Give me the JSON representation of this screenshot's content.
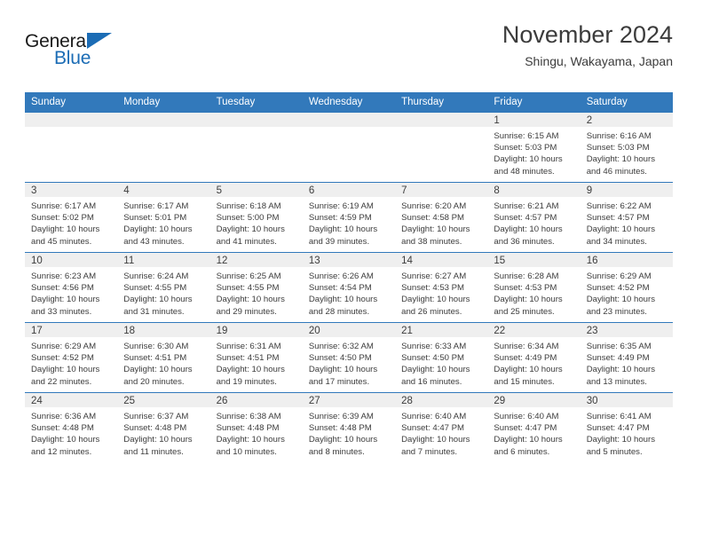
{
  "brand": {
    "name_part1": "General",
    "name_part2": "Blue",
    "accent_color": "#1b6cb5"
  },
  "header": {
    "title": "November 2024",
    "subtitle": "Shingu, Wakayama, Japan"
  },
  "theme": {
    "header_bg": "#3279bb",
    "daynum_bg": "#efefef",
    "text": "#3c3c3c"
  },
  "weekday_headers": [
    "Sunday",
    "Monday",
    "Tuesday",
    "Wednesday",
    "Thursday",
    "Friday",
    "Saturday"
  ],
  "weeks": [
    [
      {
        "day": "",
        "lines": []
      },
      {
        "day": "",
        "lines": []
      },
      {
        "day": "",
        "lines": []
      },
      {
        "day": "",
        "lines": []
      },
      {
        "day": "",
        "lines": []
      },
      {
        "day": "1",
        "lines": [
          "Sunrise: 6:15 AM",
          "Sunset: 5:03 PM",
          "Daylight: 10 hours",
          "and 48 minutes."
        ]
      },
      {
        "day": "2",
        "lines": [
          "Sunrise: 6:16 AM",
          "Sunset: 5:03 PM",
          "Daylight: 10 hours",
          "and 46 minutes."
        ]
      }
    ],
    [
      {
        "day": "3",
        "lines": [
          "Sunrise: 6:17 AM",
          "Sunset: 5:02 PM",
          "Daylight: 10 hours",
          "and 45 minutes."
        ]
      },
      {
        "day": "4",
        "lines": [
          "Sunrise: 6:17 AM",
          "Sunset: 5:01 PM",
          "Daylight: 10 hours",
          "and 43 minutes."
        ]
      },
      {
        "day": "5",
        "lines": [
          "Sunrise: 6:18 AM",
          "Sunset: 5:00 PM",
          "Daylight: 10 hours",
          "and 41 minutes."
        ]
      },
      {
        "day": "6",
        "lines": [
          "Sunrise: 6:19 AM",
          "Sunset: 4:59 PM",
          "Daylight: 10 hours",
          "and 39 minutes."
        ]
      },
      {
        "day": "7",
        "lines": [
          "Sunrise: 6:20 AM",
          "Sunset: 4:58 PM",
          "Daylight: 10 hours",
          "and 38 minutes."
        ]
      },
      {
        "day": "8",
        "lines": [
          "Sunrise: 6:21 AM",
          "Sunset: 4:57 PM",
          "Daylight: 10 hours",
          "and 36 minutes."
        ]
      },
      {
        "day": "9",
        "lines": [
          "Sunrise: 6:22 AM",
          "Sunset: 4:57 PM",
          "Daylight: 10 hours",
          "and 34 minutes."
        ]
      }
    ],
    [
      {
        "day": "10",
        "lines": [
          "Sunrise: 6:23 AM",
          "Sunset: 4:56 PM",
          "Daylight: 10 hours",
          "and 33 minutes."
        ]
      },
      {
        "day": "11",
        "lines": [
          "Sunrise: 6:24 AM",
          "Sunset: 4:55 PM",
          "Daylight: 10 hours",
          "and 31 minutes."
        ]
      },
      {
        "day": "12",
        "lines": [
          "Sunrise: 6:25 AM",
          "Sunset: 4:55 PM",
          "Daylight: 10 hours",
          "and 29 minutes."
        ]
      },
      {
        "day": "13",
        "lines": [
          "Sunrise: 6:26 AM",
          "Sunset: 4:54 PM",
          "Daylight: 10 hours",
          "and 28 minutes."
        ]
      },
      {
        "day": "14",
        "lines": [
          "Sunrise: 6:27 AM",
          "Sunset: 4:53 PM",
          "Daylight: 10 hours",
          "and 26 minutes."
        ]
      },
      {
        "day": "15",
        "lines": [
          "Sunrise: 6:28 AM",
          "Sunset: 4:53 PM",
          "Daylight: 10 hours",
          "and 25 minutes."
        ]
      },
      {
        "day": "16",
        "lines": [
          "Sunrise: 6:29 AM",
          "Sunset: 4:52 PM",
          "Daylight: 10 hours",
          "and 23 minutes."
        ]
      }
    ],
    [
      {
        "day": "17",
        "lines": [
          "Sunrise: 6:29 AM",
          "Sunset: 4:52 PM",
          "Daylight: 10 hours",
          "and 22 minutes."
        ]
      },
      {
        "day": "18",
        "lines": [
          "Sunrise: 6:30 AM",
          "Sunset: 4:51 PM",
          "Daylight: 10 hours",
          "and 20 minutes."
        ]
      },
      {
        "day": "19",
        "lines": [
          "Sunrise: 6:31 AM",
          "Sunset: 4:51 PM",
          "Daylight: 10 hours",
          "and 19 minutes."
        ]
      },
      {
        "day": "20",
        "lines": [
          "Sunrise: 6:32 AM",
          "Sunset: 4:50 PM",
          "Daylight: 10 hours",
          "and 17 minutes."
        ]
      },
      {
        "day": "21",
        "lines": [
          "Sunrise: 6:33 AM",
          "Sunset: 4:50 PM",
          "Daylight: 10 hours",
          "and 16 minutes."
        ]
      },
      {
        "day": "22",
        "lines": [
          "Sunrise: 6:34 AM",
          "Sunset: 4:49 PM",
          "Daylight: 10 hours",
          "and 15 minutes."
        ]
      },
      {
        "day": "23",
        "lines": [
          "Sunrise: 6:35 AM",
          "Sunset: 4:49 PM",
          "Daylight: 10 hours",
          "and 13 minutes."
        ]
      }
    ],
    [
      {
        "day": "24",
        "lines": [
          "Sunrise: 6:36 AM",
          "Sunset: 4:48 PM",
          "Daylight: 10 hours",
          "and 12 minutes."
        ]
      },
      {
        "day": "25",
        "lines": [
          "Sunrise: 6:37 AM",
          "Sunset: 4:48 PM",
          "Daylight: 10 hours",
          "and 11 minutes."
        ]
      },
      {
        "day": "26",
        "lines": [
          "Sunrise: 6:38 AM",
          "Sunset: 4:48 PM",
          "Daylight: 10 hours",
          "and 10 minutes."
        ]
      },
      {
        "day": "27",
        "lines": [
          "Sunrise: 6:39 AM",
          "Sunset: 4:48 PM",
          "Daylight: 10 hours",
          "and 8 minutes."
        ]
      },
      {
        "day": "28",
        "lines": [
          "Sunrise: 6:40 AM",
          "Sunset: 4:47 PM",
          "Daylight: 10 hours",
          "and 7 minutes."
        ]
      },
      {
        "day": "29",
        "lines": [
          "Sunrise: 6:40 AM",
          "Sunset: 4:47 PM",
          "Daylight: 10 hours",
          "and 6 minutes."
        ]
      },
      {
        "day": "30",
        "lines": [
          "Sunrise: 6:41 AM",
          "Sunset: 4:47 PM",
          "Daylight: 10 hours",
          "and 5 minutes."
        ]
      }
    ]
  ]
}
